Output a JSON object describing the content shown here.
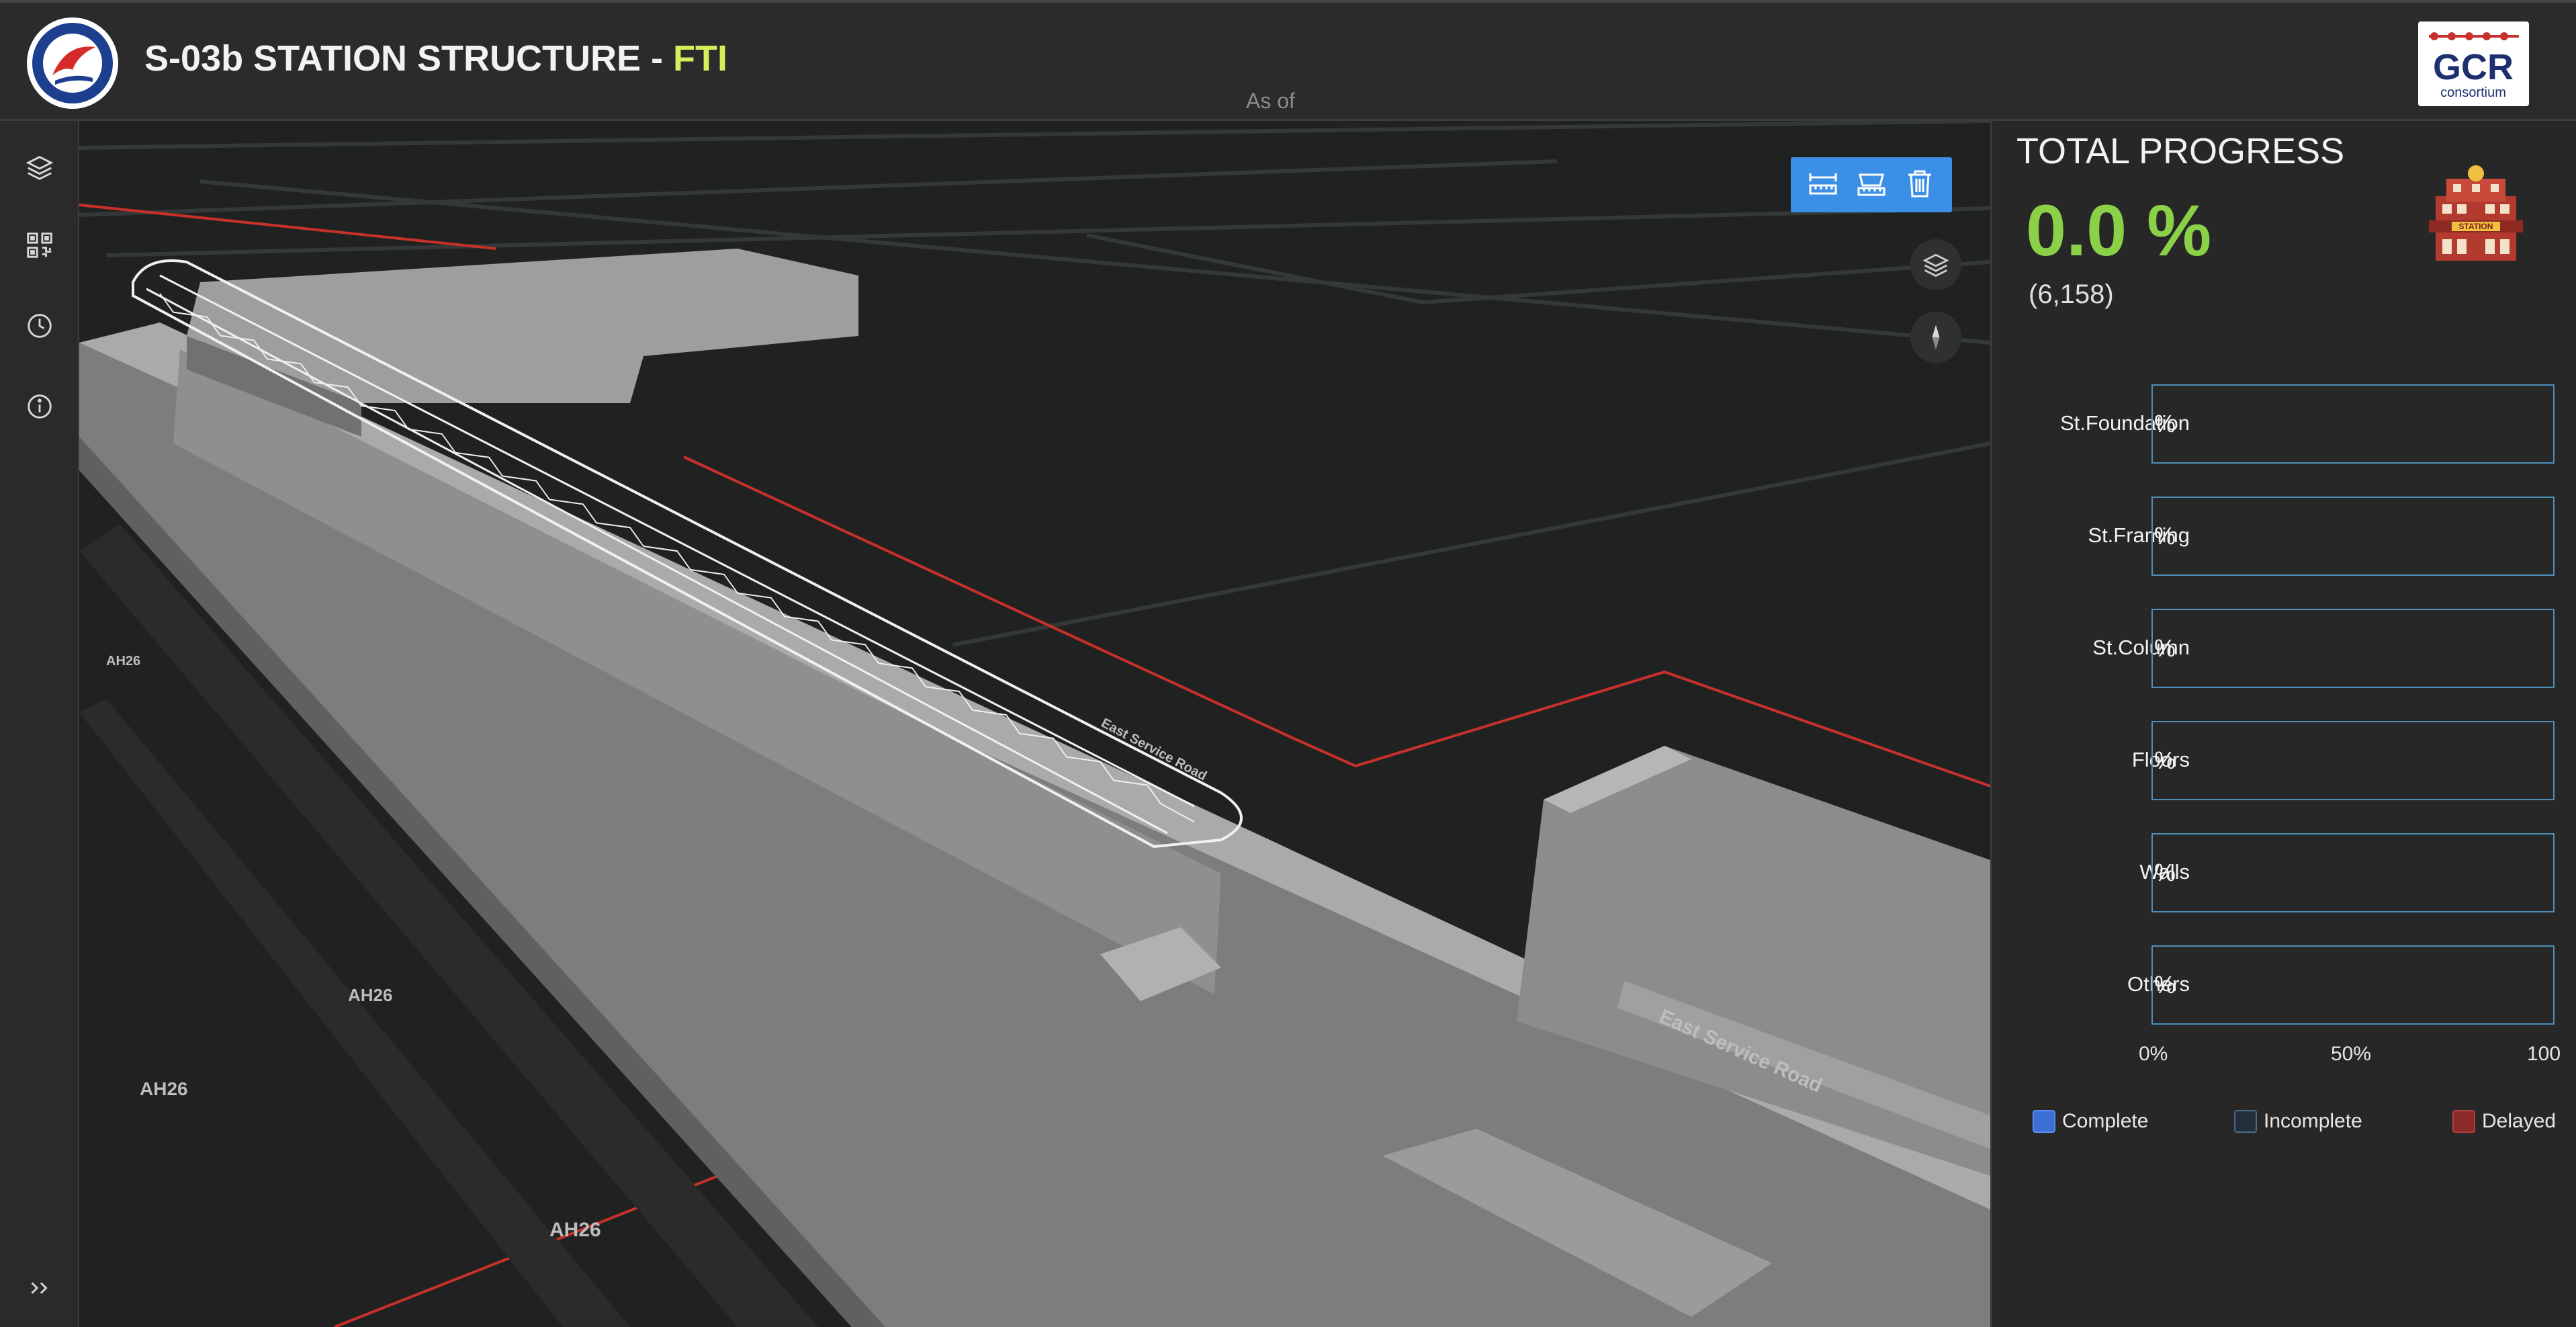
{
  "header": {
    "title_main": "S-03b STATION STRUCTURE - ",
    "title_accent": "FTI",
    "as_of": "As of",
    "seal_text": "Department of Transportation 1899",
    "logo_text": "GCR",
    "logo_sub": "consortium"
  },
  "rail": {
    "items": [
      "layers-icon",
      "qr-grid-icon",
      "clock-icon",
      "info-icon"
    ],
    "expand": "»"
  },
  "scene": {
    "road_labels": [
      "AH26",
      "AH26",
      "AH26",
      "AH26",
      "East Service Road",
      "East Service Road"
    ],
    "toolbar": [
      "measure-distance-icon",
      "measure-area-icon",
      "trash-icon"
    ]
  },
  "panel": {
    "title": "TOTAL PROGRESS",
    "value": "0.0 %",
    "count": "(6,158)",
    "rows": [
      {
        "label": "St.Foundation",
        "value": "%",
        "progress": 0
      },
      {
        "label": "St.Framing",
        "value": "%",
        "progress": 0
      },
      {
        "label": "St.Column",
        "value": "%",
        "progress": 0
      },
      {
        "label": "Floors",
        "value": "%",
        "progress": 0
      },
      {
        "label": "Walls",
        "value": "%",
        "progress": 0
      },
      {
        "label": "Others",
        "value": "%",
        "progress": 0
      }
    ],
    "axis": [
      "0%",
      "50%",
      "100"
    ],
    "legend": [
      {
        "label": "Complete",
        "color": "#3b6fd6"
      },
      {
        "label": "Incomplete",
        "color": "#2a3a4a"
      },
      {
        "label": "Delayed",
        "color": "#8b2a2a"
      }
    ],
    "accent_color": "#8bd148"
  }
}
